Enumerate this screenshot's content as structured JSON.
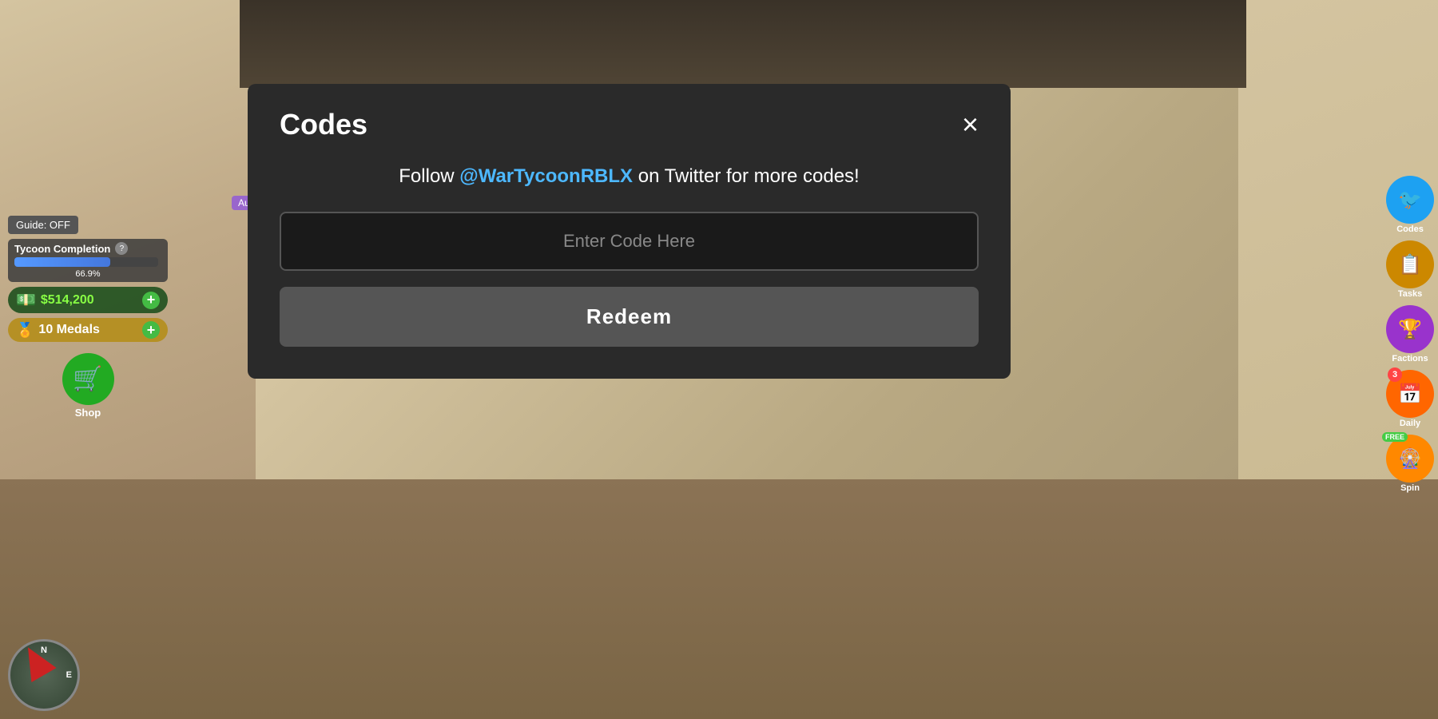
{
  "background": {
    "color": "#c8b89a"
  },
  "ui": {
    "guide_label": "Guide: OFF",
    "tycoon": {
      "label": "Tycoon Completion",
      "progress": 66.9,
      "progress_text": "66.9%"
    },
    "money": {
      "amount": "$514,200",
      "icon": "💵"
    },
    "medals": {
      "amount": "10 Medals",
      "icon": "🏅"
    },
    "shop": {
      "label": "Shop",
      "icon": "🛒"
    },
    "auto_label": "Auto"
  },
  "right_sidebar": {
    "items": [
      {
        "id": "codes",
        "label": "Codes",
        "icon": "🐦",
        "color": "#1da1f2",
        "badge": null
      },
      {
        "id": "tasks",
        "label": "Tasks",
        "icon": "📋",
        "color": "#cc8800",
        "badge": null
      },
      {
        "id": "factions",
        "label": "Factions",
        "icon": "🏆",
        "color": "#9933cc",
        "badge": null
      },
      {
        "id": "daily",
        "label": "Daily",
        "icon": "📅",
        "color": "#ff6600",
        "badge": "3"
      },
      {
        "id": "spin",
        "label": "Spin",
        "icon": "🎡",
        "color": "#ff8800",
        "badge": "FREE"
      }
    ]
  },
  "modal": {
    "title": "Codes",
    "close_label": "×",
    "follow_text_before": "Follow ",
    "follow_handle": "@WarTycoonRBLX",
    "follow_text_after": " on Twitter for more codes!",
    "input_placeholder": "Enter Code Here",
    "redeem_label": "Redeem"
  }
}
